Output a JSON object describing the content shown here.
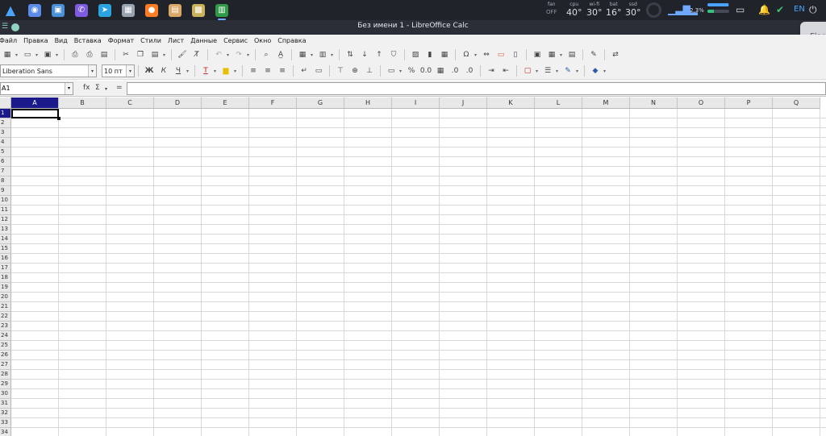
{
  "taskbar": {
    "apps": [
      {
        "name": "arch-logo-icon",
        "glyph": "▲",
        "color": "#4aa3ff"
      },
      {
        "name": "chromium-icon",
        "glyph": "◉",
        "color": "#5b8de8"
      },
      {
        "name": "files-icon",
        "glyph": "▣",
        "color": "#4a90d9"
      },
      {
        "name": "viber-icon",
        "glyph": "✆",
        "color": "#7d5ae0"
      },
      {
        "name": "telegram-icon",
        "glyph": "➤",
        "color": "#2aa3e0"
      },
      {
        "name": "calculator-icon",
        "glyph": "▦",
        "color": "#9aa3b0"
      },
      {
        "name": "firefox-icon",
        "glyph": "●",
        "color": "#ff7b24"
      },
      {
        "name": "archive-icon",
        "glyph": "▤",
        "color": "#d9a766"
      },
      {
        "name": "keyring-icon",
        "glyph": "▩",
        "color": "#c9b25a"
      },
      {
        "name": "libreoffice-calc-icon",
        "glyph": "▥",
        "color": "#2f9a47"
      }
    ],
    "sensors": [
      {
        "label": "fan",
        "value": "OFF"
      },
      {
        "label": "cpu",
        "value": "40°"
      },
      {
        "label": "wi-fi",
        "value": "30°"
      },
      {
        "label": "bat",
        "value": "16°"
      },
      {
        "label": "ssd",
        "value": "30°"
      }
    ],
    "net_speed": "2,3%",
    "lang": "EN",
    "bar_fill_cpu": 0.95,
    "bar_fill_mem": 0.3
  },
  "window": {
    "title": "Без имени 1 - LibreOffice Calc"
  },
  "notification": {
    "text": "Flar"
  },
  "menu": [
    "Файл",
    "Правка",
    "Вид",
    "Вставка",
    "Формат",
    "Стили",
    "Лист",
    "Данные",
    "Сервис",
    "Окно",
    "Справка"
  ],
  "toolbar2": {
    "font_name": "Liberation Sans",
    "font_size": "10 пт",
    "bold": "Ж",
    "italic": "К",
    "underline": "Ч"
  },
  "formula": {
    "cell_ref": "A1",
    "fx": "fx",
    "sum": "Σ",
    "equals": "=",
    "value": ""
  },
  "grid": {
    "columns": [
      "A",
      "B",
      "C",
      "D",
      "E",
      "F",
      "G",
      "H",
      "I",
      "J",
      "K",
      "L",
      "M",
      "N",
      "O",
      "P",
      "Q"
    ],
    "selected_column": "A",
    "selected_row": 1,
    "row_count": 34
  }
}
